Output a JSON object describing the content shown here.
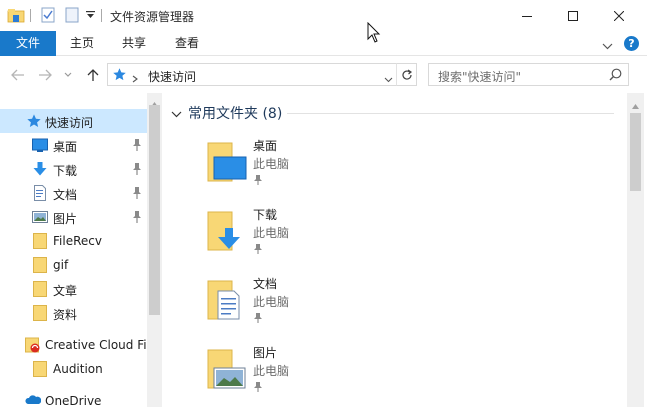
{
  "window": {
    "title": "文件资源管理器"
  },
  "ribbon": {
    "tabs": [
      "文件",
      "主页",
      "共享",
      "查看"
    ]
  },
  "address": {
    "path": "快速访问",
    "search_placeholder": "搜索\"快速访问\""
  },
  "nav": {
    "items": [
      {
        "label": "快速访问",
        "icon": "star-icon",
        "pinned": false
      },
      {
        "label": "桌面",
        "icon": "desktop-icon",
        "pinned": true
      },
      {
        "label": "下载",
        "icon": "download-icon",
        "pinned": true
      },
      {
        "label": "文档",
        "icon": "document-icon",
        "pinned": true
      },
      {
        "label": "图片",
        "icon": "picture-icon",
        "pinned": true
      },
      {
        "label": "FileRecv",
        "icon": "folder-icon",
        "pinned": false
      },
      {
        "label": "gif",
        "icon": "folder-icon",
        "pinned": false
      },
      {
        "label": "文章",
        "icon": "folder-icon",
        "pinned": false
      },
      {
        "label": "资料",
        "icon": "folder-icon",
        "pinned": false
      },
      {
        "label": "Creative Cloud Fil",
        "icon": "creative-cloud-icon",
        "pinned": false
      },
      {
        "label": "Audition",
        "icon": "folder-icon",
        "pinned": false
      },
      {
        "label": "OneDrive",
        "icon": "onedrive-icon",
        "pinned": false
      }
    ]
  },
  "content": {
    "group_title": "常用文件夹 (8)",
    "tiles": [
      {
        "name": "桌面",
        "location": "此电脑",
        "icon": "desktop-folder-icon"
      },
      {
        "name": "下载",
        "location": "此电脑",
        "icon": "download-folder-icon"
      },
      {
        "name": "文档",
        "location": "此电脑",
        "icon": "document-folder-icon"
      },
      {
        "name": "图片",
        "location": "此电脑",
        "icon": "picture-folder-icon"
      }
    ]
  },
  "colors": {
    "accent": "#1979ca",
    "selection": "#cce8ff",
    "folder": "#f8d775",
    "group_header": "#1e395b"
  }
}
